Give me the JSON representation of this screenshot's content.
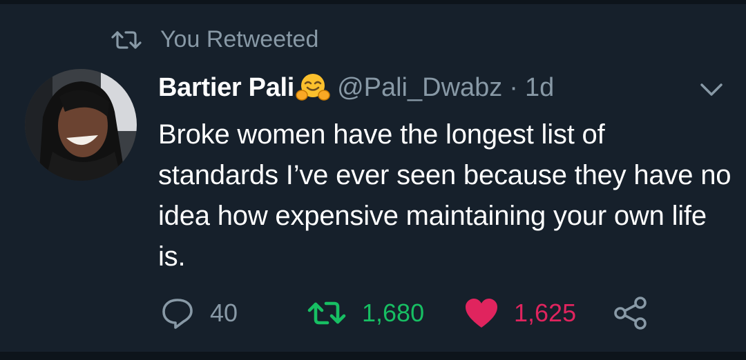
{
  "retweet_context": {
    "text": "You Retweeted",
    "icon": "retweet-icon"
  },
  "tweet": {
    "display_name": "Bartier Pali",
    "name_emoji": "hugging-face-emoji",
    "handle": "@Pali_Dwabz",
    "separator": "·",
    "time": "1d",
    "text": "Broke women have the longest list of standards I’ve ever seen because they have no idea how expensive maintaining your own life is."
  },
  "actions": {
    "reply": {
      "icon": "reply-icon",
      "count": "40"
    },
    "retweet": {
      "icon": "retweet-icon",
      "count": "1,680",
      "color": "#17bf63"
    },
    "like": {
      "icon": "heart-icon",
      "count": "1,625",
      "color": "#e0245e"
    },
    "share": {
      "icon": "share-icon"
    }
  },
  "colors": {
    "background": "#16202b",
    "secondary_text": "#8899a6",
    "primary_text": "#ffffff"
  }
}
